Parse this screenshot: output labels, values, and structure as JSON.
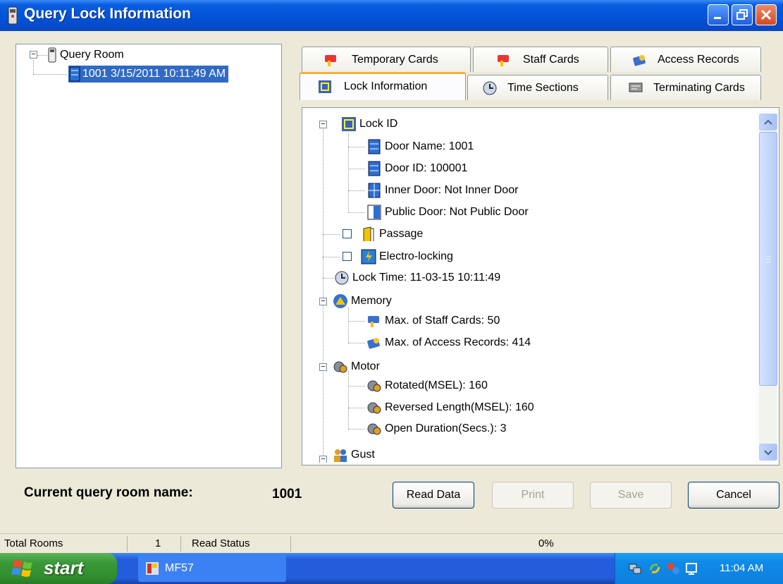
{
  "window": {
    "title": "Query Lock Information"
  },
  "left_tree": {
    "root_label": "Query Room",
    "child_label": "1001 3/15/2011 10:11:49 AM"
  },
  "tabs": {
    "temporary_cards": "Temporary Cards",
    "staff_cards": "Staff Cards",
    "access_records": "Access Records",
    "lock_information": "Lock Information",
    "time_sections": "Time Sections",
    "terminating_cards": "Terminating Cards",
    "selected": "Lock Information"
  },
  "lock_tree": {
    "lock_id": "Lock ID",
    "door_name": "Door Name: 1001",
    "door_id": "Door ID: 100001",
    "inner_door": "Inner Door: Not Inner Door",
    "public_door": "Public Door: Not Public Door",
    "passage": "Passage",
    "electro_locking": "Electro-locking",
    "lock_time": "Lock Time: 11-03-15 10:11:49",
    "memory": "Memory",
    "max_staff_cards": "Max. of Staff Cards: 50",
    "max_access_records": "Max. of Access Records: 414",
    "motor": "Motor",
    "rotated": "Rotated(MSEL): 160",
    "reversed_length": "Reversed Length(MSEL): 160",
    "open_duration": "Open Duration(Secs.): 3",
    "gust": "Gust"
  },
  "current_room": {
    "label": "Current query room name:",
    "value": "1001"
  },
  "buttons": {
    "read_data": "Read Data",
    "print": "Print",
    "save": "Save",
    "cancel": "Cancel"
  },
  "status_bar": {
    "total_rooms_label": "Total Rooms",
    "total_rooms_value": "1",
    "read_status_label": "Read Status",
    "progress_text": "0%"
  },
  "taskbar": {
    "start_label": "start",
    "task_item": "MF57",
    "clock": "11:04 AM"
  }
}
